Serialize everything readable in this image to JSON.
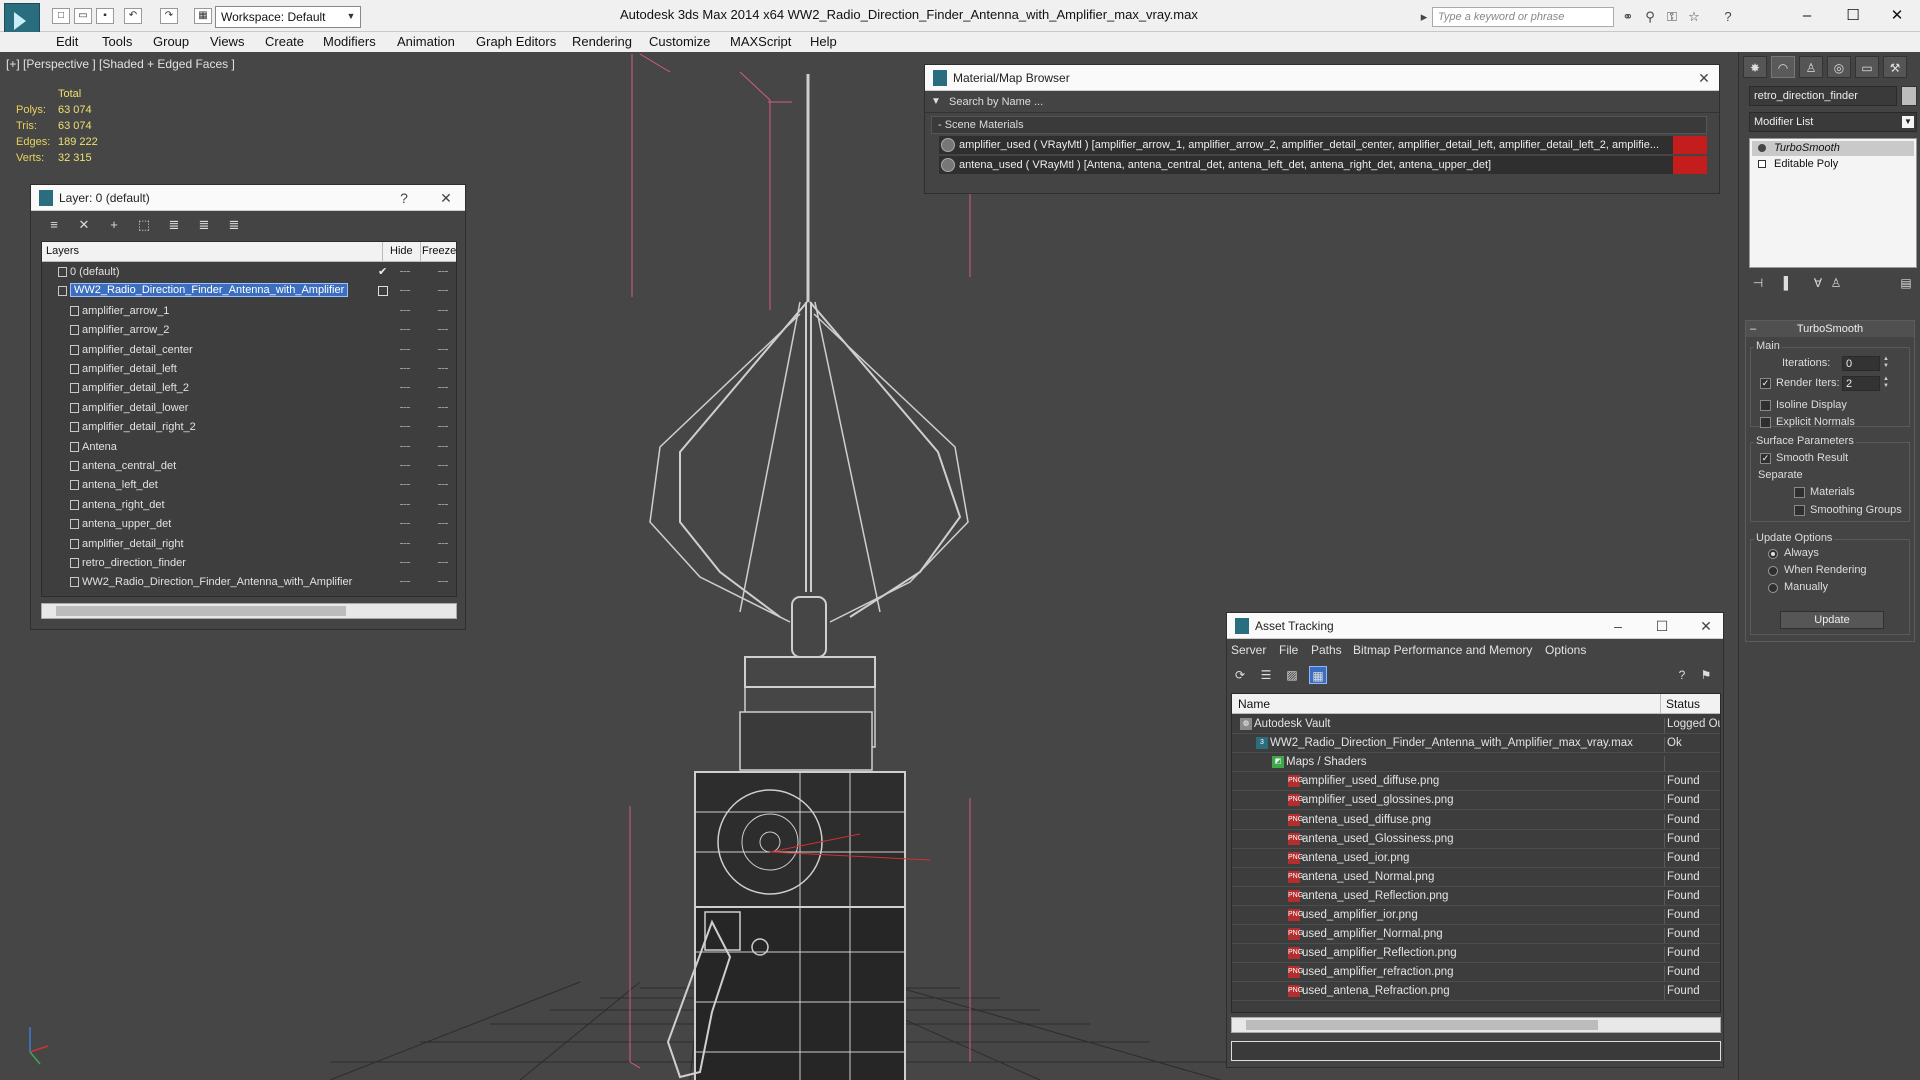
{
  "titlebar": {
    "workspace": "Workspace: Default",
    "title": "Autodesk 3ds Max  2014 x64     WW2_Radio_Direction_Finder_Antenna_with_Amplifier_max_vray.max",
    "search_placeholder": "Type a keyword or phrase"
  },
  "menu": [
    "Edit",
    "Tools",
    "Group",
    "Views",
    "Create",
    "Modifiers",
    "Animation",
    "Graph Editors",
    "Rendering",
    "Customize",
    "MAXScript",
    "Help"
  ],
  "viewport": {
    "label": "[+] [Perspective ] [Shaded + Edged Faces ]",
    "stats": {
      "header": "Total",
      "rows": [
        {
          "label": "Polys:",
          "value": "63 074"
        },
        {
          "label": "Tris:",
          "value": "63 074"
        },
        {
          "label": "Edges:",
          "value": "189 222"
        },
        {
          "label": "Verts:",
          "value": "32 315"
        }
      ]
    }
  },
  "layer_window": {
    "title": "Layer: 0 (default)",
    "help": "?",
    "columns": {
      "layers": "Layers",
      "hide": "Hide",
      "freeze": "Freeze"
    },
    "rows": [
      {
        "name": "0 (default)",
        "level": 1,
        "checked": true
      },
      {
        "name": "WW2_Radio_Direction_Finder_Antenna_with_Amplifier",
        "level": 1,
        "selected": true
      },
      {
        "name": "amplifier_arrow_1",
        "level": 2
      },
      {
        "name": "amplifier_arrow_2",
        "level": 2
      },
      {
        "name": "amplifier_detail_center",
        "level": 2
      },
      {
        "name": "amplifier_detail_left",
        "level": 2
      },
      {
        "name": "amplifier_detail_left_2",
        "level": 2
      },
      {
        "name": "amplifier_detail_lower",
        "level": 2
      },
      {
        "name": "amplifier_detail_right_2",
        "level": 2
      },
      {
        "name": "Antena",
        "level": 2
      },
      {
        "name": "antena_central_det",
        "level": 2
      },
      {
        "name": "antena_left_det",
        "level": 2
      },
      {
        "name": "antena_right_det",
        "level": 2
      },
      {
        "name": "antena_upper_det",
        "level": 2
      },
      {
        "name": "amplifier_detail_right",
        "level": 2
      },
      {
        "name": "retro_direction_finder",
        "level": 2
      },
      {
        "name": "WW2_Radio_Direction_Finder_Antenna_with_Amplifier",
        "level": 2
      }
    ]
  },
  "material_browser": {
    "title": "Material/Map Browser",
    "search": "Search by Name ...",
    "section": "- Scene Materials",
    "rows": [
      "amplifier_used  ( VRayMtl ) [amplifier_arrow_1, amplifier_arrow_2, amplifier_detail_center, amplifier_detail_left, amplifier_detail_left_2, amplifie...",
      "antena_used  ( VRayMtl ) [Antena, antena_central_det, antena_left_det, antena_right_det, antena_upper_det]"
    ]
  },
  "command_panel": {
    "object_name": "retro_direction_finder",
    "modifier_list": "Modifier List",
    "stack": [
      {
        "name": "TurboSmooth",
        "active": true
      },
      {
        "name": "Editable Poly",
        "active": false
      }
    ],
    "turbosmooth": {
      "title": "TurboSmooth",
      "main": "Main",
      "iterations_label": "Iterations:",
      "iterations_value": "0",
      "render_iters_label": "Render Iters:",
      "render_iters_value": "2",
      "render_iters_checked": true,
      "isoline": "Isoline Display",
      "explicit_normals": "Explicit Normals",
      "surface_params": "Surface Parameters",
      "smooth_result": "Smooth Result",
      "separate": "Separate",
      "materials": "Materials",
      "smoothing_groups": "Smoothing Groups",
      "update_options": "Update Options",
      "always": "Always",
      "when_rendering": "When Rendering",
      "manually": "Manually",
      "update": "Update"
    }
  },
  "asset_tracking": {
    "title": "Asset Tracking",
    "menu": [
      "Server",
      "File",
      "Paths",
      "Bitmap Performance and Memory",
      "Options"
    ],
    "columns": {
      "name": "Name",
      "status": "Status"
    },
    "rows": [
      {
        "name": "Autodesk Vault",
        "status": "Logged Ou",
        "indent": 1,
        "icon": "vault"
      },
      {
        "name": "WW2_Radio_Direction_Finder_Antenna_with_Amplifier_max_vray.max",
        "status": "Ok",
        "indent": 2,
        "icon": "max"
      },
      {
        "name": "Maps / Shaders",
        "status": "",
        "indent": 3,
        "icon": "maps"
      },
      {
        "name": "amplifier_used_diffuse.png",
        "status": "Found",
        "indent": 4,
        "icon": "png"
      },
      {
        "name": "amplifier_used_glossines.png",
        "status": "Found",
        "indent": 4,
        "icon": "png"
      },
      {
        "name": "antena_used_diffuse.png",
        "status": "Found",
        "indent": 4,
        "icon": "png"
      },
      {
        "name": "antena_used_Glossiness.png",
        "status": "Found",
        "indent": 4,
        "icon": "png"
      },
      {
        "name": "antena_used_ior.png",
        "status": "Found",
        "indent": 4,
        "icon": "png"
      },
      {
        "name": "antena_used_Normal.png",
        "status": "Found",
        "indent": 4,
        "icon": "png"
      },
      {
        "name": "antena_used_Reflection.png",
        "status": "Found",
        "indent": 4,
        "icon": "png"
      },
      {
        "name": "used_amplifier_ior.png",
        "status": "Found",
        "indent": 4,
        "icon": "png"
      },
      {
        "name": "used_amplifier_Normal.png",
        "status": "Found",
        "indent": 4,
        "icon": "png"
      },
      {
        "name": "used_amplifier_Reflection.png",
        "status": "Found",
        "indent": 4,
        "icon": "png"
      },
      {
        "name": "used_amplifier_refraction.png",
        "status": "Found",
        "indent": 4,
        "icon": "png"
      },
      {
        "name": "used_antena_Refraction.png",
        "status": "Found",
        "indent": 4,
        "icon": "png"
      }
    ]
  },
  "colors": {
    "viewport_bg": "#464646",
    "stats_text": "#e8d35a",
    "selection": "#3c6ec0",
    "material_flag": "#c41d1d"
  }
}
